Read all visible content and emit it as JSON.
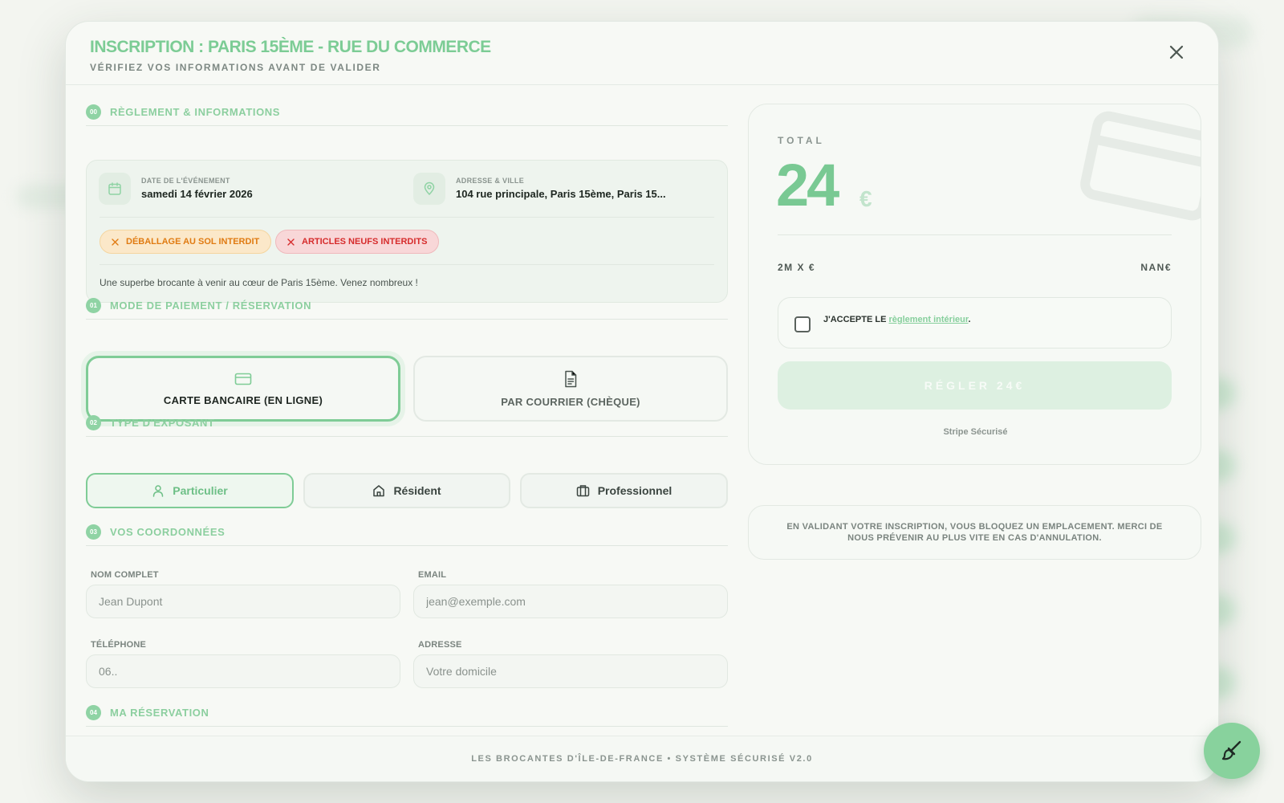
{
  "modal": {
    "title": "INSCRIPTION : PARIS 15ÈME - RUE DU COMMERCE",
    "subtitle": "VÉRIFIEZ VOS INFORMATIONS AVANT DE VALIDER"
  },
  "sections": {
    "s0": {
      "num": "00",
      "label": "RÈGLEMENT & INFORMATIONS"
    },
    "s1": {
      "num": "01",
      "label": "MODE DE PAIEMENT / RÉSERVATION"
    },
    "s2": {
      "num": "02",
      "label": "TYPE D'EXPOSANT"
    },
    "s3": {
      "num": "03",
      "label": "VOS COORDONNÉES"
    },
    "s4": {
      "num": "04",
      "label": "MA RÉSERVATION"
    }
  },
  "event": {
    "date_label": "DATE DE L'ÉVÉNEMENT",
    "date_value": "samedi 14 février 2026",
    "address_label": "ADRESSE & VILLE",
    "address_value": "104 rue principale, Paris 15ème, Paris 15...",
    "badge_orange": "DÉBALLAGE AU SOL INTERDIT",
    "badge_red": "ARTICLES NEUFS INTERDITS",
    "description": "Une superbe brocante à venir au cœur de Paris 15ème. Venez nombreux !"
  },
  "payment": {
    "card_label": "CARTE BANCAIRE (EN LIGNE)",
    "mail_label": "PAR COURRIER (CHÈQUE)",
    "selected": "card"
  },
  "exhibitor": {
    "particulier": "Particulier",
    "resident": "Résident",
    "professionnel": "Professionnel",
    "selected": "particulier"
  },
  "form": {
    "name_label": "NOM COMPLET",
    "name_placeholder": "Jean Dupont",
    "email_label": "EMAIL",
    "email_placeholder": "jean@exemple.com",
    "phone_label": "TÉLÉPHONE",
    "phone_placeholder": "06..",
    "address_label": "ADRESSE",
    "address_placeholder": "Votre domicile"
  },
  "summary": {
    "total_label": "TOTAL",
    "total_amount": "24",
    "currency": "€",
    "price_line_left": "2M X €",
    "price_line_right": "NAN€",
    "accept_prefix": "J'ACCEPTE LE",
    "accept_link": "règlement intérieur",
    "accept_suffix": ".",
    "pay_button": "RÉGLER 24€",
    "secure_text": "Stripe Sécurisé",
    "notice": "EN VALIDANT VOTRE INSCRIPTION, VOUS BLOQUEZ UN EMPLACEMENT. MERCI DE NOUS PRÉVENIR AU PLUS VITE EN CAS D'ANNULATION."
  },
  "footer": {
    "text": "LES BROCANTES D'ÎLE-DE-FRANCE • SYSTÈME SÉCURISÉ V2.0"
  },
  "colors": {
    "accent": "#7ccc95",
    "badge_orange": "#e07b12",
    "badge_red": "#d62c2c",
    "background": "#f3f5f0"
  },
  "icons": {
    "close": "close-icon",
    "calendar": "calendar-icon",
    "location": "map-pin-icon",
    "card": "credit-card-icon",
    "document": "document-icon",
    "user": "user-icon",
    "home": "home-icon",
    "briefcase": "briefcase-icon",
    "paintbrush": "paintbrush-icon"
  }
}
